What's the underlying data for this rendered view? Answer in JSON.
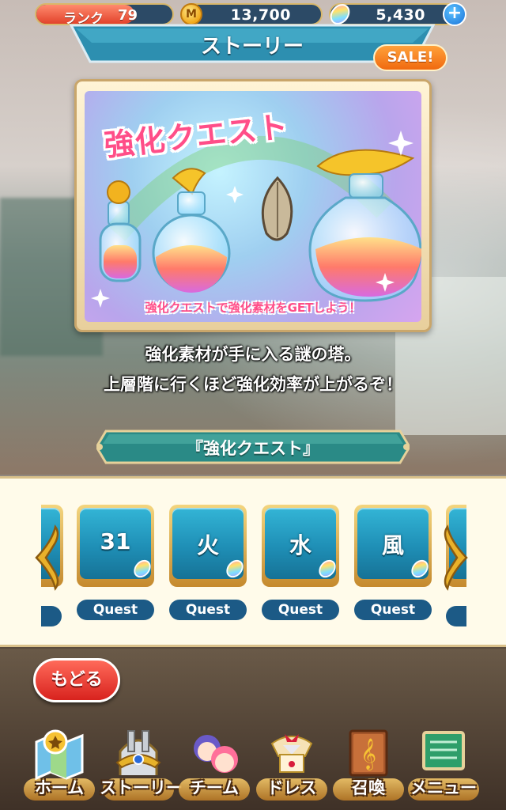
{
  "status_bar": {
    "rank_label": "ランク",
    "rank_value": "79",
    "rank_progress": 0.72,
    "coin_value": "13,700",
    "gem_value": "5,430"
  },
  "header": {
    "title": "ストーリー",
    "sale_badge": "SALE!"
  },
  "banner": {
    "title": "強化クエスト",
    "caption": "強化クエストで強化素材をGETしよう！"
  },
  "description": {
    "line1": "強化素材が手に入る謎の塔。",
    "line2": "上層階に行くほど強化効率が上がるぞ！"
  },
  "section": {
    "title": "『強化クエスト』"
  },
  "quests": [
    {
      "label": "31",
      "pill": "Quest"
    },
    {
      "label": "火",
      "pill": "Quest"
    },
    {
      "label": "水",
      "pill": "Quest"
    },
    {
      "label": "風",
      "pill": "Quest"
    }
  ],
  "back_button": "もどる",
  "nav": [
    {
      "label": "ホーム",
      "icon": "map-icon"
    },
    {
      "label": "ストーリー",
      "icon": "gate-icon"
    },
    {
      "label": "チーム",
      "icon": "team-icon"
    },
    {
      "label": "ドレス",
      "icon": "dress-icon"
    },
    {
      "label": "召喚",
      "icon": "book-icon"
    },
    {
      "label": "メニュー",
      "icon": "menu-board-icon"
    }
  ],
  "colors": {
    "accent_blue": "#1f8fb6",
    "rank_red": "#e2432b",
    "sale_orange": "#f06a10",
    "banner_pink": "#ff4e88"
  }
}
